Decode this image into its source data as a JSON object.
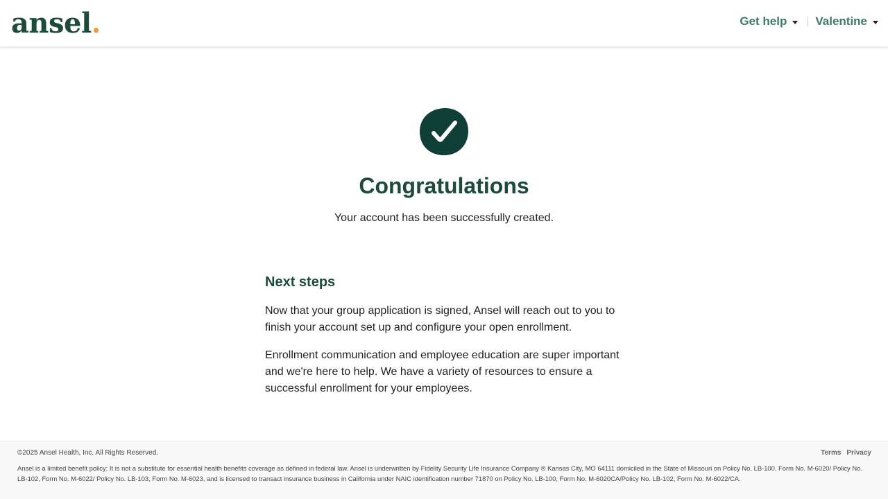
{
  "header": {
    "logo": {
      "text": "ansel",
      "dot": "."
    },
    "nav": {
      "help_label": "Get help",
      "user_label": "Valentine"
    }
  },
  "main": {
    "icon": "check-circle-icon",
    "title": "Congratulations",
    "subtitle": "Your account has been successfully created.",
    "next_steps": {
      "title": "Next steps",
      "paragraphs": [
        "Now that your group application is signed, Ansel will reach out to you to finish your account set up and configure your open enrollment.",
        "Enrollment communication and employee education are super important and we're here to help. We have a variety of resources to ensure a successful enrollment for your employees."
      ]
    }
  },
  "footer": {
    "copyright": "©2025 Ansel Health, Inc. All Rights Reserved.",
    "links": {
      "terms": "Terms",
      "privacy": "Privacy"
    },
    "disclaimer": "Ansel is a limited benefit policy; It is not a substitute for essential health benefits coverage as defined in federal law. Ansel is underwritten by Fidelity Security Life Insurance Company ® Kansas City, MO 64111 domiciled in the State of Missouri on Policy No. LB-100, Form No. M-6020/ Policy No. LB-102, Form No. M-6022/ Policy No. LB-103, Form No. M-6023, and is licensed to transact insurance business in California under NAIC identification number 71870 on Policy No. LB-100, Form No. M-6020CA/Policy No. LB-102, Form No. M-6022/CA."
  },
  "colors": {
    "brand_green": "#1d4a3d",
    "link_green": "#3d7a65",
    "logo_dot": "#e8a33d"
  }
}
